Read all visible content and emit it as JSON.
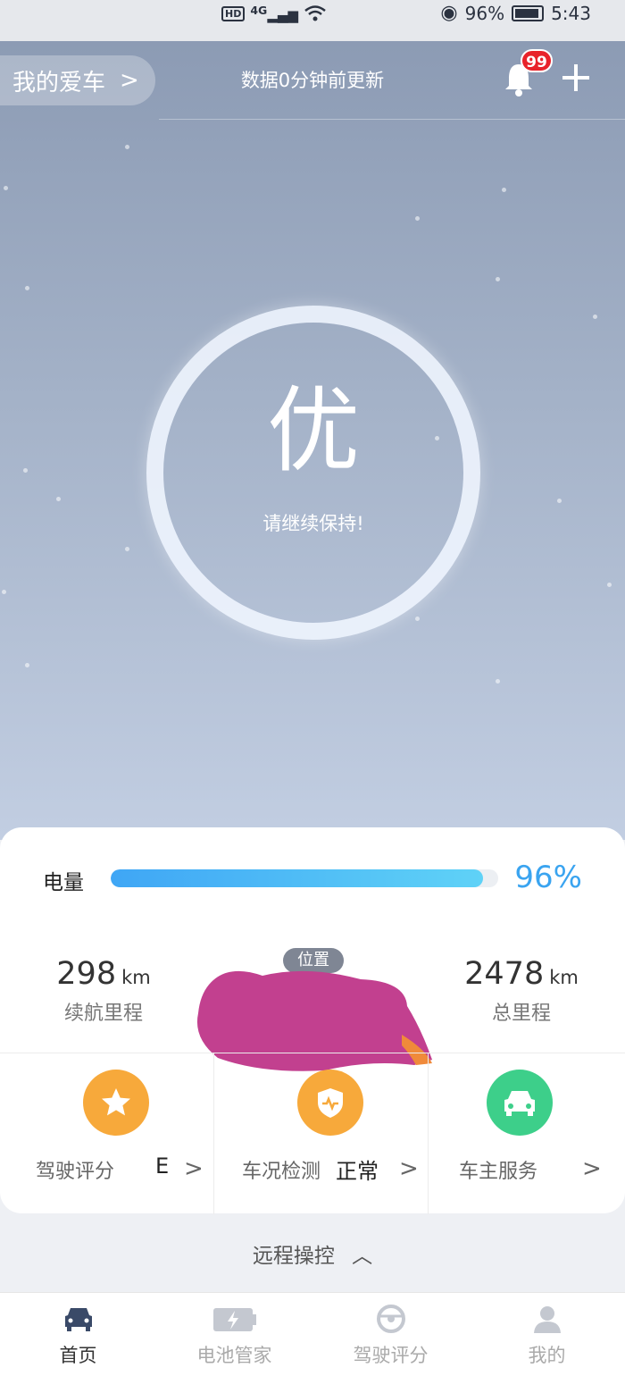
{
  "status_bar": {
    "hd": "HD",
    "network": "4G",
    "battery": "96%",
    "time": "5:43"
  },
  "header": {
    "car_selector": "我的爱车",
    "update_text": "数据0分钟前更新",
    "notification_count": "99"
  },
  "score": {
    "grade": "优",
    "message": "请继续保持!"
  },
  "battery": {
    "label": "电量",
    "percent_text": "96%",
    "level": 0.96
  },
  "stats": {
    "range": {
      "value": "298",
      "unit": "km",
      "label": "续航里程"
    },
    "location": {
      "label": "位置"
    },
    "total": {
      "value": "2478",
      "unit": "km",
      "label": "总里程"
    }
  },
  "tiles": [
    {
      "label": "驾驶评分",
      "value": "E",
      "icon": "star-icon",
      "color": "#f7a93b"
    },
    {
      "label": "车况检测",
      "value": "正常",
      "icon": "shield-pulse-icon",
      "color": "#f7a93b"
    },
    {
      "label": "车主服务",
      "value": "",
      "icon": "car-icon",
      "color": "#3dcf8a"
    }
  ],
  "remote": {
    "label": "远程操控"
  },
  "tabs": [
    {
      "label": "首页",
      "icon": "car-icon",
      "active": true
    },
    {
      "label": "电池管家",
      "icon": "battery-bolt-icon",
      "active": false
    },
    {
      "label": "驾驶评分",
      "icon": "steering-wheel-icon",
      "active": false
    },
    {
      "label": "我的",
      "icon": "user-icon",
      "active": false
    }
  ],
  "colors": {
    "accent": "#3aa4f0",
    "badge": "#e8222a",
    "tile_orange": "#f7a93b",
    "tile_green": "#3dcf8a"
  }
}
